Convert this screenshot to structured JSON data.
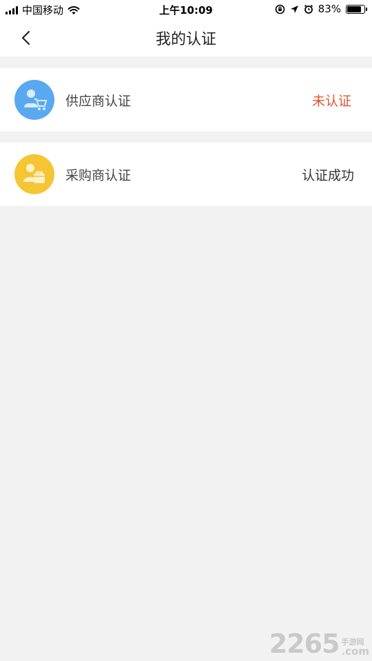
{
  "status_bar": {
    "carrier": "中国移动",
    "time": "上午10:09",
    "battery": "83%",
    "battery_level": 0.83,
    "icons": [
      "signal-icon",
      "wifi-icon",
      "lock-rotation-icon",
      "location-icon",
      "alarm-icon",
      "battery-icon"
    ]
  },
  "nav": {
    "title": "我的认证",
    "back_icon": "chevron-left-icon"
  },
  "certifications": [
    {
      "label": "供应商认证",
      "status": "未认证",
      "status_color": "#e0542c",
      "icon": "supplier-icon",
      "icon_color": "#5aa9f0"
    },
    {
      "label": "采购商认证",
      "status": "认证成功",
      "status_color": "#333333",
      "icon": "purchaser-icon",
      "icon_color": "#f5c534"
    }
  ],
  "watermark": {
    "number": "2265",
    "site_cn": "手游网",
    "suffix": ".com"
  }
}
